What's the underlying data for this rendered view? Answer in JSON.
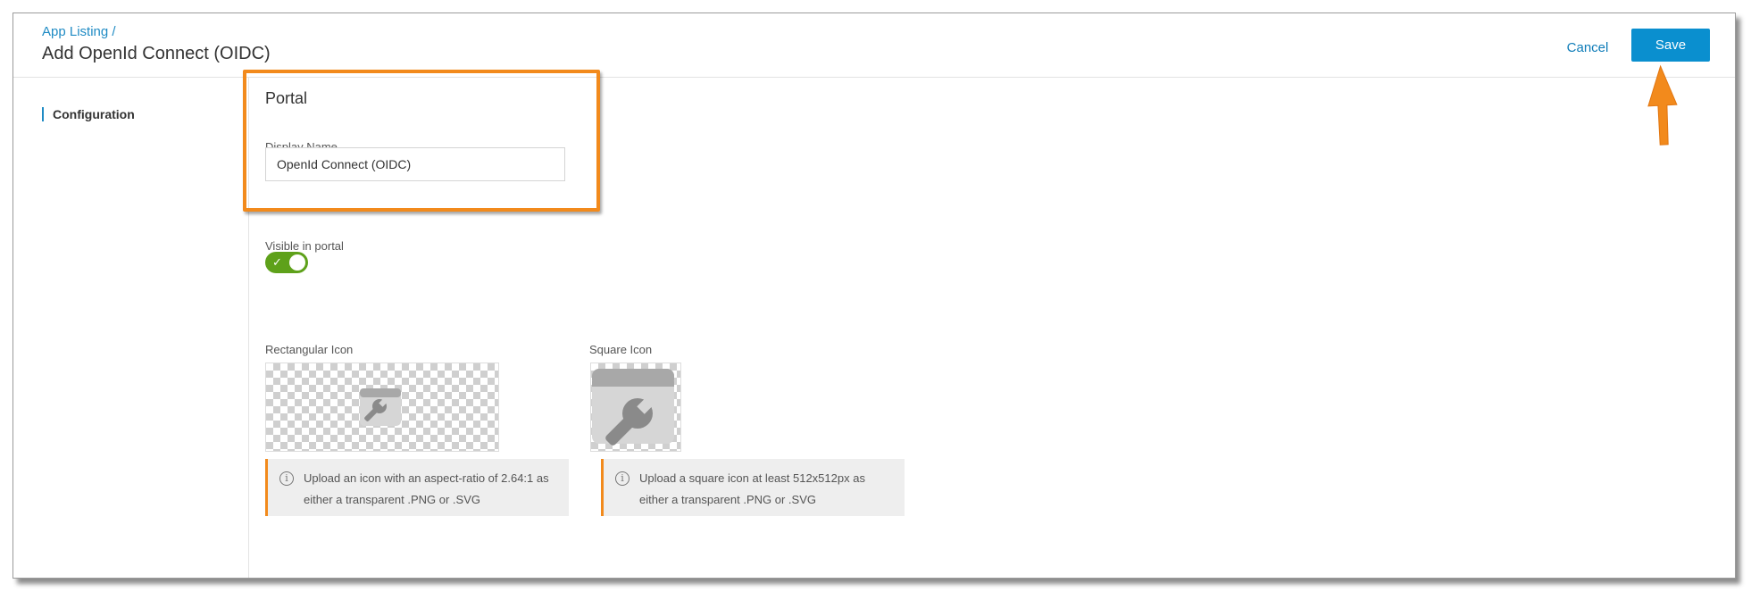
{
  "header": {
    "breadcrumb": "App Listing /",
    "title": "Add OpenId Connect (OIDC)",
    "cancel_label": "Cancel",
    "save_label": "Save"
  },
  "sidebar": {
    "items": [
      {
        "label": "Configuration",
        "active": true
      }
    ]
  },
  "portal": {
    "section_title": "Portal",
    "display_name_label": "Display Name",
    "display_name_value": "OpenId Connect (OIDC)",
    "visible_label": "Visible in portal",
    "visible_toggle": {
      "on": true,
      "icon": "check-icon"
    }
  },
  "icons": {
    "rectangular": {
      "label": "Rectangular Icon",
      "placeholder_icon": "wrench-app-icon",
      "note": "Upload an icon with an aspect-ratio of 2.64:1 as either a transparent .PNG or .SVG"
    },
    "square": {
      "label": "Square Icon",
      "placeholder_icon": "wrench-app-icon",
      "note": "Upload a square icon at least 512x512px as either a transparent .PNG or .SVG"
    }
  },
  "colors": {
    "accent_blue": "#0a8fcf",
    "link_blue": "#1f8bc4",
    "toggle_green": "#5ea11a",
    "highlight_orange": "#f28a1c"
  }
}
